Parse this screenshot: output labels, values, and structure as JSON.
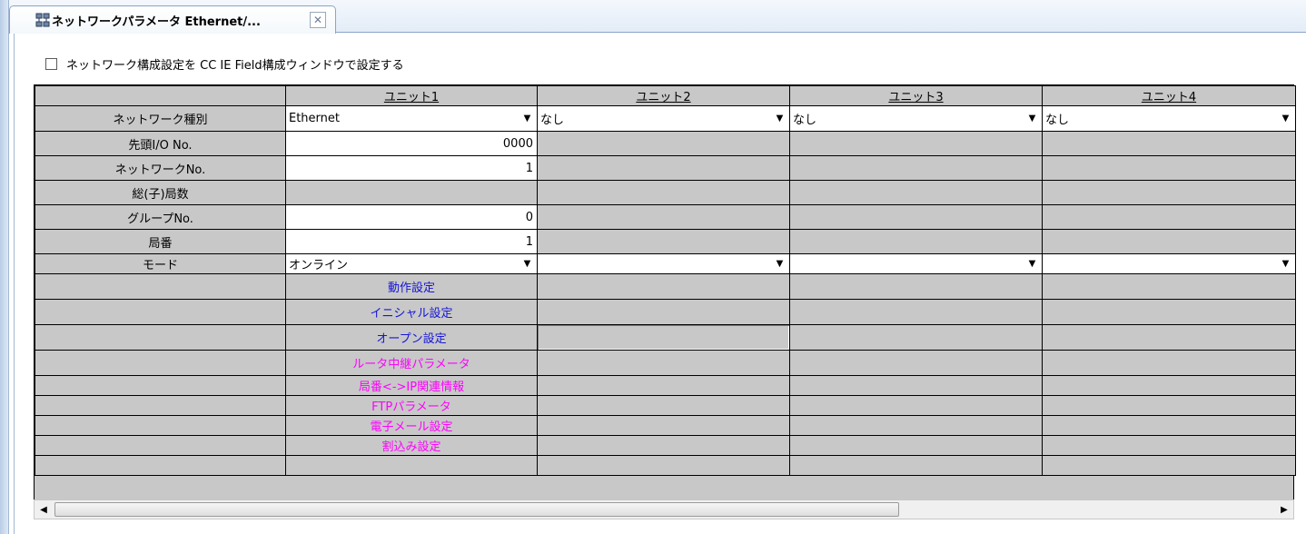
{
  "tab": {
    "title": "ネットワークパラメータ Ethernet/...",
    "icon": "network-params-icon",
    "close_icon": "close-icon"
  },
  "option": {
    "label": "ネットワーク構成設定を CC IE Field構成ウィンドウで設定する",
    "checked": false
  },
  "grid": {
    "columns": [
      "",
      "ユニット1",
      "ユニット2",
      "ユニット3",
      "ユニット4"
    ],
    "network_type": {
      "label": "ネットワーク種別",
      "values": [
        "Ethernet",
        "なし",
        "なし",
        "なし"
      ]
    },
    "start_io": {
      "label": "先頭I/O No.",
      "value": "0000"
    },
    "network_no": {
      "label": "ネットワークNo.",
      "value": "1"
    },
    "total_stations": {
      "label": "総(子)局数"
    },
    "group_no": {
      "label": "グループNo.",
      "value": "0"
    },
    "station_no": {
      "label": "局番",
      "value": "1"
    },
    "mode": {
      "label": "モード",
      "values": [
        "オンライン",
        "",
        "",
        ""
      ]
    },
    "links": [
      {
        "label": "動作設定",
        "color": "#1515d8"
      },
      {
        "label": "イニシャル設定",
        "color": "#1515d8"
      },
      {
        "label": "オープン設定",
        "color": "#1515d8"
      },
      {
        "label": "ルータ中継パラメータ",
        "color": "#ff00ff"
      },
      {
        "label": "局番<->IP関連情報",
        "color": "#ff00ff"
      },
      {
        "label": "FTPパラメータ",
        "color": "#ff00ff"
      },
      {
        "label": "電子メール設定",
        "color": "#ff00ff"
      },
      {
        "label": "割込み設定",
        "color": "#ff00ff"
      }
    ]
  },
  "scrollbar": {
    "left_icon": "arrow-left-icon",
    "right_icon": "arrow-right-icon"
  }
}
